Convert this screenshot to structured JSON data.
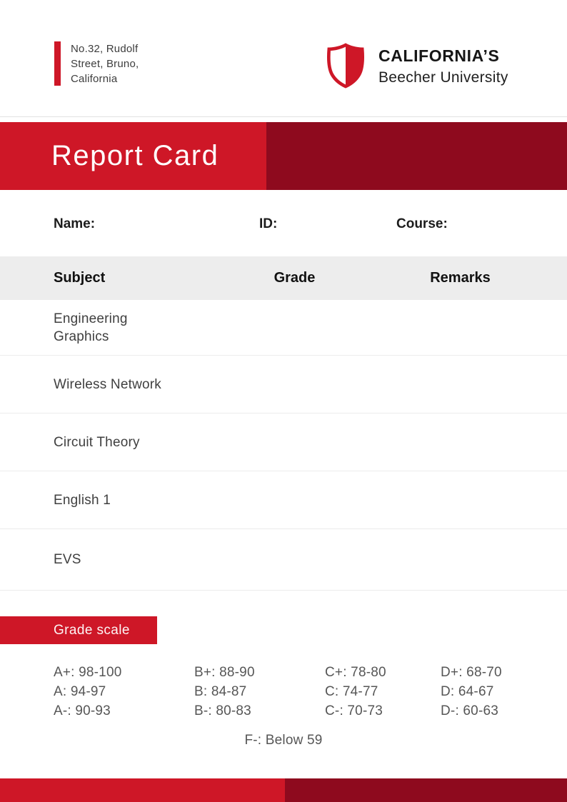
{
  "colors": {
    "accent_red": "#ce1727",
    "dark_red": "#8e0a1e"
  },
  "header": {
    "address_lines": [
      "No.32, Rudolf",
      "Street, Bruno,",
      "California"
    ],
    "logo_icon": "shield-icon",
    "university_name": "CALIFORNIA’S",
    "university_subtitle": "Beecher University"
  },
  "banner": {
    "title": "Report Card"
  },
  "student_fields": {
    "name_label": "Name:",
    "id_label": "ID:",
    "course_label": "Course:"
  },
  "table": {
    "columns": [
      "Subject",
      "Grade",
      "Remarks"
    ],
    "rows": [
      {
        "subject": "Engineering Graphics",
        "grade": "",
        "remarks": ""
      },
      {
        "subject": "Wireless Network",
        "grade": "",
        "remarks": ""
      },
      {
        "subject": "Circuit Theory",
        "grade": "",
        "remarks": ""
      },
      {
        "subject": "English 1",
        "grade": "",
        "remarks": ""
      },
      {
        "subject": "EVS",
        "grade": "",
        "remarks": ""
      }
    ]
  },
  "grade_scale": {
    "title": "Grade scale",
    "columns": [
      [
        "A+: 98-100",
        "A: 94-97",
        "A-: 90-93"
      ],
      [
        "B+: 88-90",
        "B: 84-87",
        "B-: 80-83"
      ],
      [
        "C+: 78-80",
        "C: 74-77",
        "C-: 70-73"
      ],
      [
        "D+: 68-70",
        "D: 64-67",
        "D-: 60-63"
      ]
    ],
    "footer": "F-: Below 59"
  }
}
